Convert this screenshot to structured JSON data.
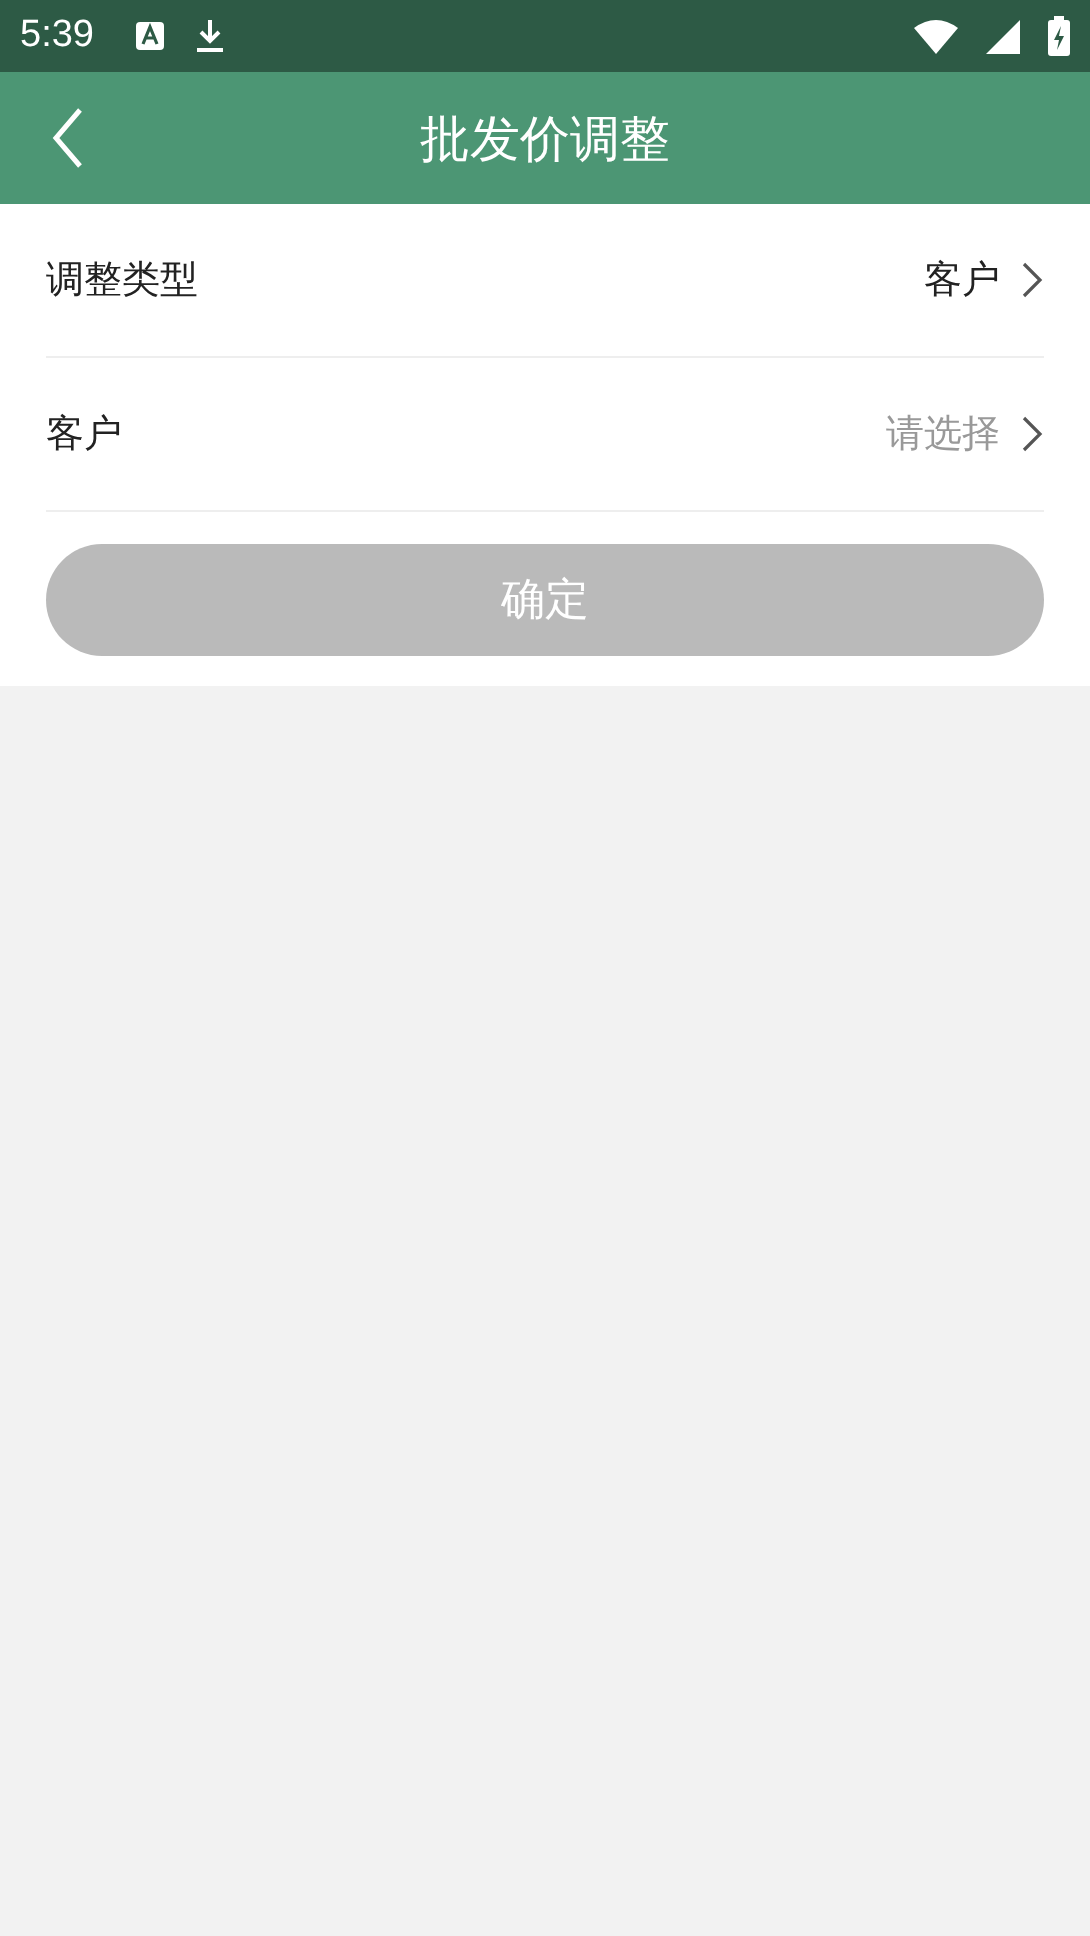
{
  "status_bar": {
    "time": "5:39"
  },
  "header": {
    "title": "批发价调整"
  },
  "rows": [
    {
      "label": "调整类型",
      "value": "客户"
    },
    {
      "label": "客户",
      "placeholder": "请选择"
    }
  ],
  "confirm_button": {
    "label": "确定",
    "disabled": true
  }
}
